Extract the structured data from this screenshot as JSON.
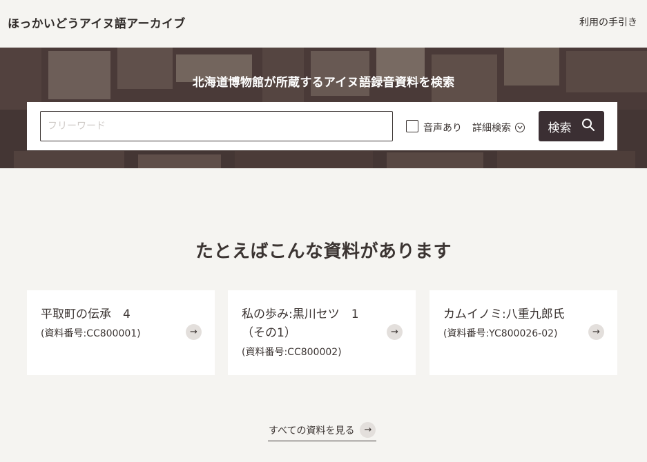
{
  "header": {
    "site_title": "ほっかいどうアイヌ語アーカイブ",
    "guide_link": "利用の手引き"
  },
  "hero": {
    "heading": "北海道博物館が所蔵するアイヌ語録音資料を検索",
    "search": {
      "placeholder": "フリーワード",
      "value": "",
      "audio_label": "音声あり",
      "audio_checked": false,
      "advanced_label": "詳細検索",
      "button_label": "検索"
    }
  },
  "examples": {
    "heading": "たとえばこんな資料があります",
    "cards": [
      {
        "title": "平取町の伝承　4",
        "id": "(資料番号:CC800001)"
      },
      {
        "title": "私の歩み:黒川セツ　1（その1）",
        "id": "(資料番号:CC800002)"
      },
      {
        "title": "カムイノミ:八重九郎氏",
        "id": "(資料番号:YC800026-02)"
      }
    ],
    "all_link": "すべての資料を見る"
  },
  "icons": {
    "search": "search-icon",
    "chevron": "chevron-down-circle-icon",
    "arrow": "arrow-right-icon"
  },
  "colors": {
    "background": "#f5f4f1",
    "text": "#3b3432",
    "button": "#3b2f33",
    "arrow_bg": "#e3dfdc"
  }
}
